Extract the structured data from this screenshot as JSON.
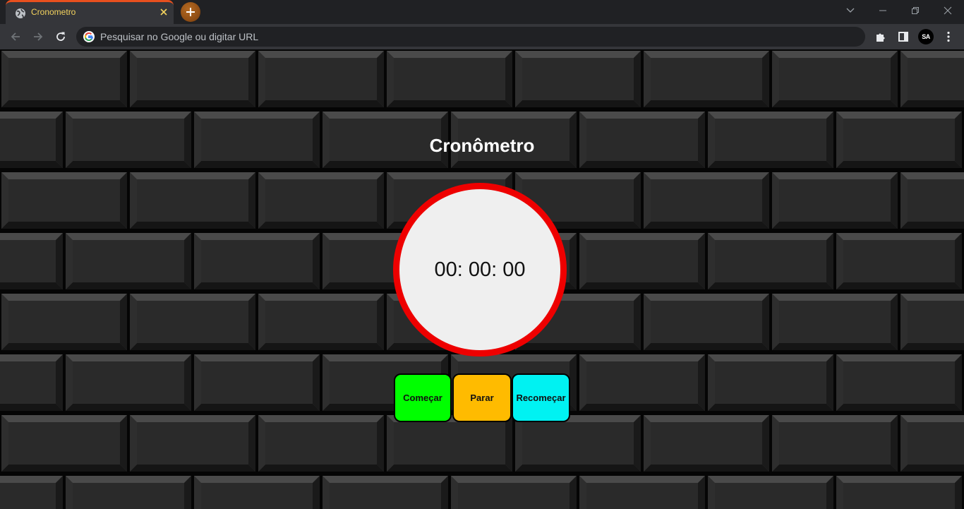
{
  "browser": {
    "tab": {
      "title": "Cronometro",
      "favicon": "globe-icon",
      "title_color": "#f4d35e",
      "accent": "#e8501e"
    },
    "omnibox": {
      "placeholder": "Pesquisar no Google ou digitar URL"
    },
    "profile": {
      "initials": "SA"
    }
  },
  "page": {
    "title": "Cronômetro",
    "display": "00: 00: 00",
    "buttons": {
      "start": "Começar",
      "stop": "Parar",
      "reset": "Recomeçar"
    }
  },
  "colors": {
    "clock_border": "#ee0000",
    "clock_face": "#efefef",
    "start": "#00ff00",
    "stop": "#ffbb00",
    "reset": "#00f2f2"
  }
}
